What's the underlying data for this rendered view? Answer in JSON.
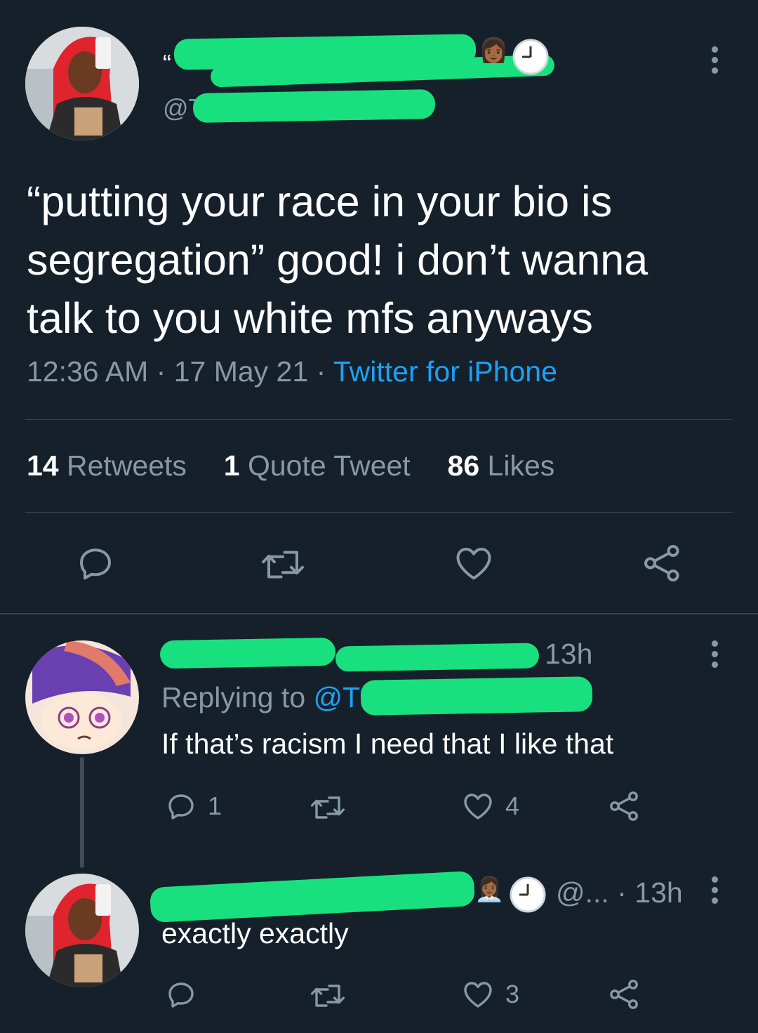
{
  "main_tweet": {
    "handle_prefix": "@T",
    "text": "“putting your race in your bio is segregation” good! i don’t wanna talk to you white mfs anyways",
    "time": "12:36 AM",
    "sep1": "·",
    "date": "17 May 21",
    "sep2": "·",
    "source": "Twitter for iPhone",
    "stats": {
      "retweets_count": "14",
      "retweets_label": "Retweets",
      "quotes_count": "1",
      "quotes_label": "Quote Tweet",
      "likes_count": "86",
      "likes_label": "Likes"
    }
  },
  "reply1": {
    "age": "13h",
    "replying_label": "Replying to",
    "replying_handle_prefix": "@T",
    "text": "If that’s racism I need that I like that",
    "reply_count": "1",
    "like_count": "4"
  },
  "reply2": {
    "handle_short": "@...",
    "sep": "·",
    "age": "13h",
    "text": "exactly exactly",
    "like_count": "3"
  },
  "colors": {
    "background": "#15202b",
    "muted": "#8899a6",
    "link": "#1da1f2",
    "divider": "#38444d",
    "redaction": "#19e07e"
  },
  "icons": [
    "reply-icon",
    "retweet-icon",
    "like-icon",
    "share-icon",
    "more-icon",
    "clock-icon",
    "person-emoji-icon"
  ]
}
